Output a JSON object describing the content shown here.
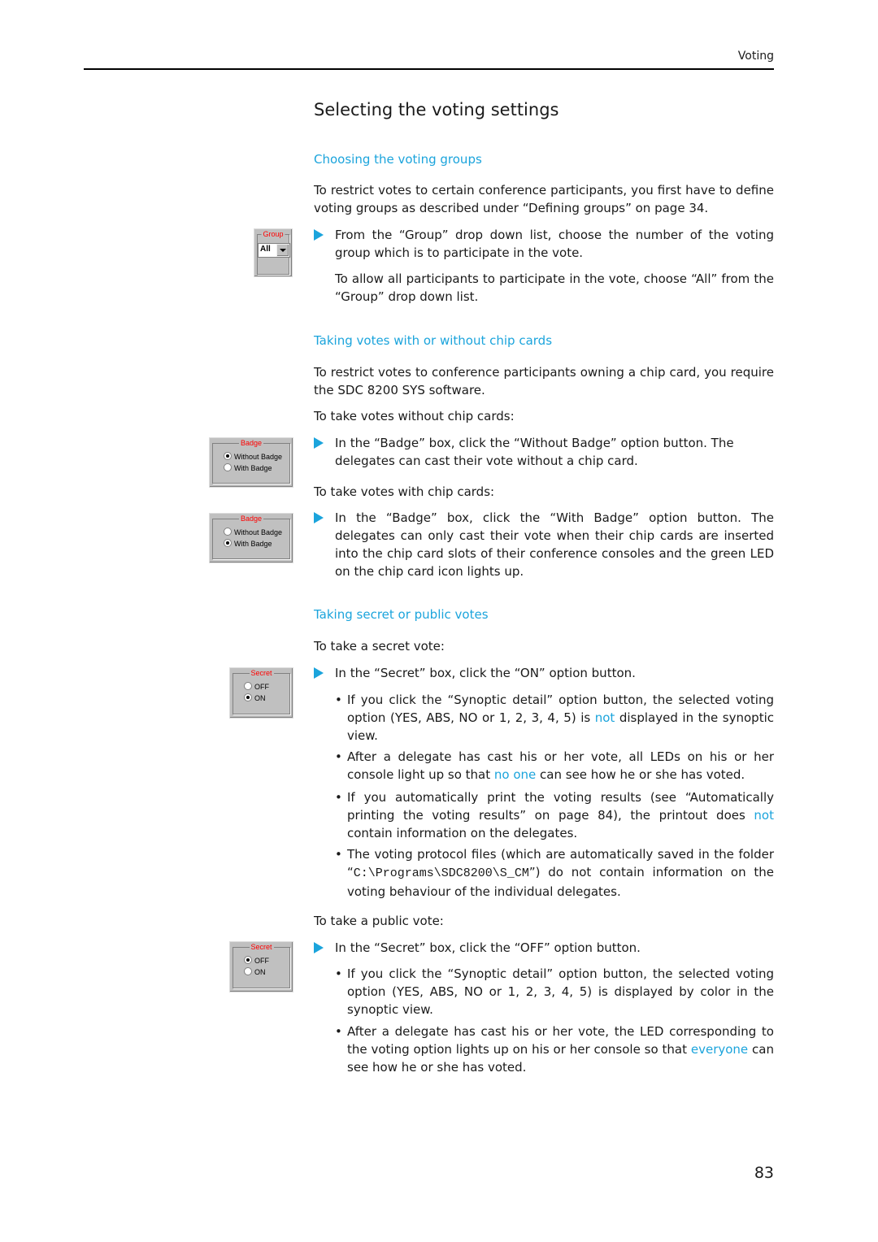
{
  "header": {
    "running_head": "Voting",
    "page_number": "83"
  },
  "title": "Selecting the voting settings",
  "accent_color": "#1ba4dc",
  "sections": {
    "groups": {
      "heading": "Choosing the voting groups",
      "intro": "To restrict votes to certain conference participants, you first have to define voting groups as described under “Defining groups” on page 34.",
      "step": "From the “Group” drop down list, choose the number of the voting group which is to participate in the vote.",
      "note": "To allow all participants to participate in the vote, choose “All” from the “Group” drop down list.",
      "widget": {
        "legend": "Group",
        "value": "All"
      }
    },
    "chip": {
      "heading": "Taking votes with or without chip cards",
      "intro": "To restrict votes to conference participants owning a chip card, you require the SDC 8200 SYS software.",
      "without_label": "To take votes without chip cards:",
      "without_step": "In the “Badge” box, click the “Without Badge” option button. The delegates can cast their vote without a chip card.",
      "with_label": "To take votes with chip cards:",
      "with_step": "In the “Badge” box, click the “With Badge” option button. The delegates can only cast their vote when their chip cards are inserted into the chip card slots of their conference consoles and the green LED on the chip card icon lights up.",
      "widget_without": {
        "legend": "Badge",
        "options": [
          "Without Badge",
          "With  Badge"
        ],
        "selected": 0
      },
      "widget_with": {
        "legend": "Badge",
        "options": [
          "Without Badge",
          "With  Badge"
        ],
        "selected": 1
      }
    },
    "secret": {
      "heading": "Taking secret or public votes",
      "secret_label": "To take a secret vote:",
      "secret_step": "In the “Secret” box, click the “ON” option button.",
      "secret_bullets": [
        {
          "a": "If you click the “Synoptic detail” option button, the selected voting option (YES, ABS, NO or 1, 2, 3, 4, 5) is ",
          "hl": "not",
          "b": " displayed in the synoptic view."
        },
        {
          "a": "After a delegate has cast his or her vote, all LEDs on his or her console light up so that ",
          "hl": "no one",
          "b": " can see how he or she has voted."
        },
        {
          "a": "If you automatically print the voting results (see “Automatically printing the voting results” on page 84), the printout does ",
          "hl": "not",
          "b": " contain information on the delegates."
        },
        {
          "a": "The voting protocol files (which are automatically saved in the folder “",
          "mono": "C:\\Programs\\SDC8200\\S_CM",
          "b": "”) do not contain information on the voting behaviour of the individual delegates."
        }
      ],
      "public_label": "To take a public vote:",
      "public_step": "In the “Secret” box, click the “OFF” option button.",
      "public_bullets": [
        {
          "a": "If you click the “Synoptic detail” option button, the selected voting option (YES, ABS, NO or 1, 2, 3, 4, 5) is displayed by color in the synoptic view.",
          "hl": "",
          "b": ""
        },
        {
          "a": "After a delegate has cast his or her vote, the LED corresponding to the voting option lights up on his or her console so that ",
          "hl": "everyone",
          "b": " can see how he or she has voted."
        }
      ],
      "widget_on": {
        "legend": "Secret",
        "options": [
          "OFF",
          "ON"
        ],
        "selected": 1
      },
      "widget_off": {
        "legend": "Secret",
        "options": [
          "OFF",
          "ON"
        ],
        "selected": 0
      }
    }
  }
}
